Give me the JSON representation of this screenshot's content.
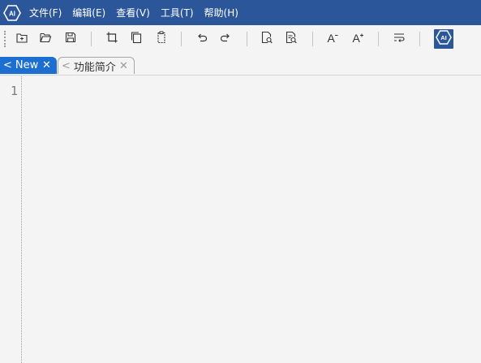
{
  "app": {
    "logo_text": "AI"
  },
  "menu": [
    {
      "label": "文件(F)"
    },
    {
      "label": "编辑(E)"
    },
    {
      "label": "查看(V)"
    },
    {
      "label": "工具(T)"
    },
    {
      "label": "帮助(H)"
    }
  ],
  "toolbar": {
    "buttons": [
      {
        "icon": "new-file-icon"
      },
      {
        "icon": "open-folder-icon"
      },
      {
        "icon": "save-icon"
      },
      {
        "icon": "cut-icon"
      },
      {
        "icon": "copy-icon"
      },
      {
        "icon": "paste-icon"
      },
      {
        "icon": "undo-icon"
      },
      {
        "icon": "redo-icon"
      },
      {
        "icon": "find-icon"
      },
      {
        "icon": "replace-icon"
      },
      {
        "icon": "font-decrease-icon",
        "text": "A"
      },
      {
        "icon": "font-increase-icon",
        "text": "A"
      },
      {
        "icon": "word-wrap-icon"
      }
    ],
    "ai_button": {
      "text": "AI"
    }
  },
  "tabs": [
    {
      "prefix": "<",
      "label": "New",
      "close": "✕",
      "active": true
    },
    {
      "prefix": "<",
      "label": "功能简介",
      "close": "✕",
      "active": false
    }
  ],
  "editor": {
    "line_numbers": [
      "1"
    ],
    "content": ""
  },
  "colors": {
    "menubar_bg": "#2b579a",
    "active_tab_bg": "#1c6fd0",
    "editor_bg": "#f4f4f4"
  }
}
